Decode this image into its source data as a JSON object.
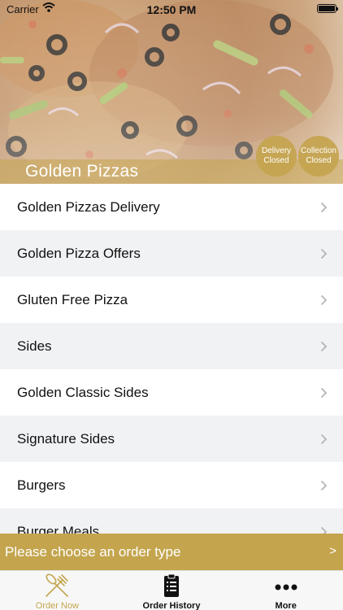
{
  "status_bar": {
    "carrier": "Carrier",
    "time": "12:50 PM"
  },
  "hero": {
    "title": "Golden Pizzas"
  },
  "status_badges": [
    {
      "line1": "Delivery",
      "line2": "Closed"
    },
    {
      "line1": "Collection",
      "line2": "Closed"
    }
  ],
  "menu": {
    "items": [
      {
        "label": "Golden Pizzas Delivery"
      },
      {
        "label": "Golden Pizza Offers"
      },
      {
        "label": "Gluten Free Pizza"
      },
      {
        "label": "Sides"
      },
      {
        "label": "Golden Classic Sides"
      },
      {
        "label": "Signature Sides"
      },
      {
        "label": "Burgers"
      },
      {
        "label": "Burger Meals"
      }
    ]
  },
  "order_bar": {
    "text": "Please choose an order type",
    "arrow": ">"
  },
  "tabs": [
    {
      "label": "Order Now",
      "icon": "fork-knife-icon",
      "active": true
    },
    {
      "label": "Order History",
      "icon": "clipboard-icon",
      "active": false
    },
    {
      "label": "More",
      "icon": "more-dots-icon",
      "active": false
    }
  ],
  "colors": {
    "accent": "#c4a54e",
    "row_alt": "#f1f2f4"
  }
}
